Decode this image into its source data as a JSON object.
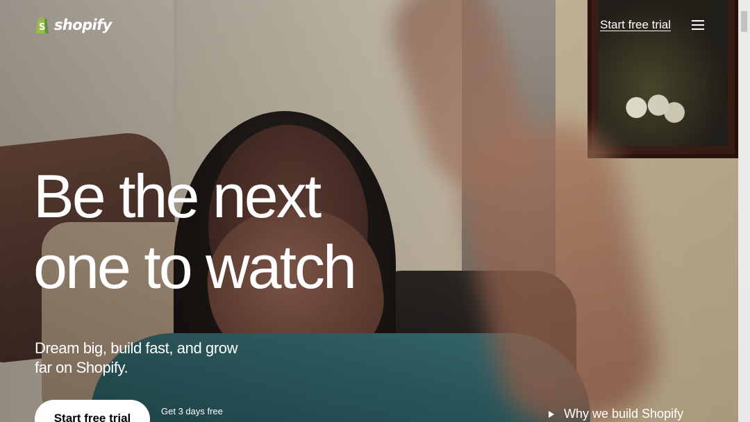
{
  "header": {
    "logo_text": "shopify",
    "cta_label": "Start free trial",
    "menu_icon": "hamburger-menu-icon"
  },
  "hero": {
    "headline_lines": [
      "Be the next",
      "one to watch"
    ],
    "subhead_lines": [
      "Dream big, build fast, and grow",
      "far on Shopify."
    ],
    "primary_cta_label": "Start free trial",
    "trial_note": "Get 3 days free",
    "video_link_label": "Why we build Shopify",
    "video_link_icon": "play-icon"
  },
  "colors": {
    "text": "#ffffff",
    "button_bg": "#ffffff",
    "button_text": "#000000",
    "logo_bag_green": "#95bf47"
  }
}
